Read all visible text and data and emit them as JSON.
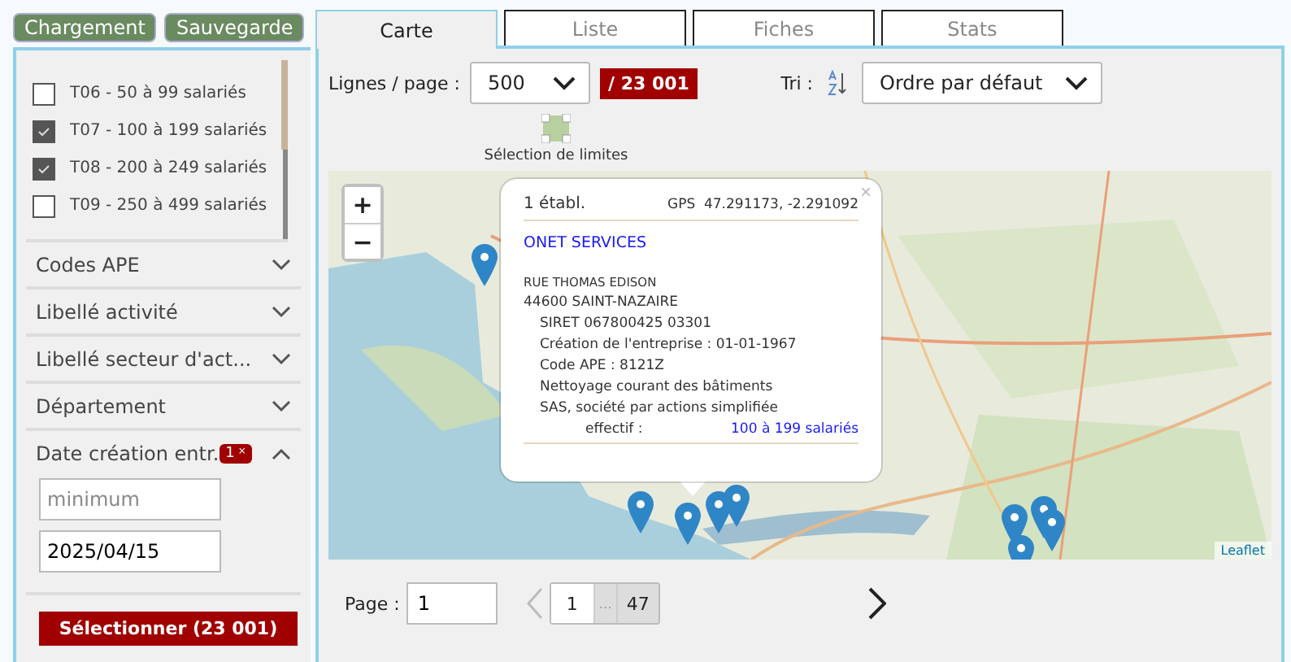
{
  "top_buttons": [
    "Chargement",
    "Sauvegarde"
  ],
  "size_filters": [
    {
      "label": "T06 - 50 à 99 salariés",
      "checked": false
    },
    {
      "label": "T07 - 100 à 199 salariés",
      "checked": true
    },
    {
      "label": "T08 - 200 à 249 salariés",
      "checked": true
    },
    {
      "label": "T09 - 250 à 499 salariés",
      "checked": false
    }
  ],
  "filters": [
    {
      "label": "Codes APE",
      "expanded": false
    },
    {
      "label": "Libellé activité",
      "expanded": false
    },
    {
      "label": "Libellé secteur d'act...",
      "expanded": false
    },
    {
      "label": "Département",
      "expanded": false
    },
    {
      "label": "Date création entr.",
      "expanded": true,
      "badge": "1",
      "badge_close": "×",
      "fields": [
        {
          "placeholder": "minimum"
        },
        {
          "value": "2025/04/15"
        }
      ]
    }
  ],
  "select_button": "Sélectionner (23 001)",
  "tabs": [
    {
      "label": "Carte",
      "selected": true
    },
    {
      "label": "Liste",
      "selected": false
    },
    {
      "label": "Fiches",
      "selected": false
    },
    {
      "label": "Stats",
      "selected": false
    }
  ],
  "toolbar": {
    "lines_label": "Lignes / page :",
    "lines_value": "500",
    "total": "/ 23 001",
    "sort_label": "Tri :",
    "sort_value": "Ordre par défaut"
  },
  "selection_tool": "Sélection de limites",
  "map": {
    "zoom_in": "+",
    "zoom_out": "−",
    "attribution": "Leaflet",
    "popup": {
      "count": "1 établ.",
      "gps": "GPS  47.291173, -2.291092",
      "close": "×",
      "company": "ONET SERVICES",
      "street": "RUE THOMAS EDISON",
      "city": "44600 SAINT-NAZAIRE",
      "details": [
        "SIRET 067800425 03301",
        "Création de l'entreprise : 01-01-1967",
        "Code APE : 8121Z",
        "Nettoyage courant des bâtiments",
        "SAS, société par actions simplifiée"
      ],
      "staff_label": "effectif :",
      "staff_value": "100 à 199 salariés"
    }
  },
  "pagination": {
    "page_label": "Page :",
    "page_value": "1",
    "pages": [
      {
        "label": "1",
        "selected": true
      },
      {
        "label": "…",
        "selected": false
      },
      {
        "label": "47",
        "selected": false
      }
    ]
  }
}
